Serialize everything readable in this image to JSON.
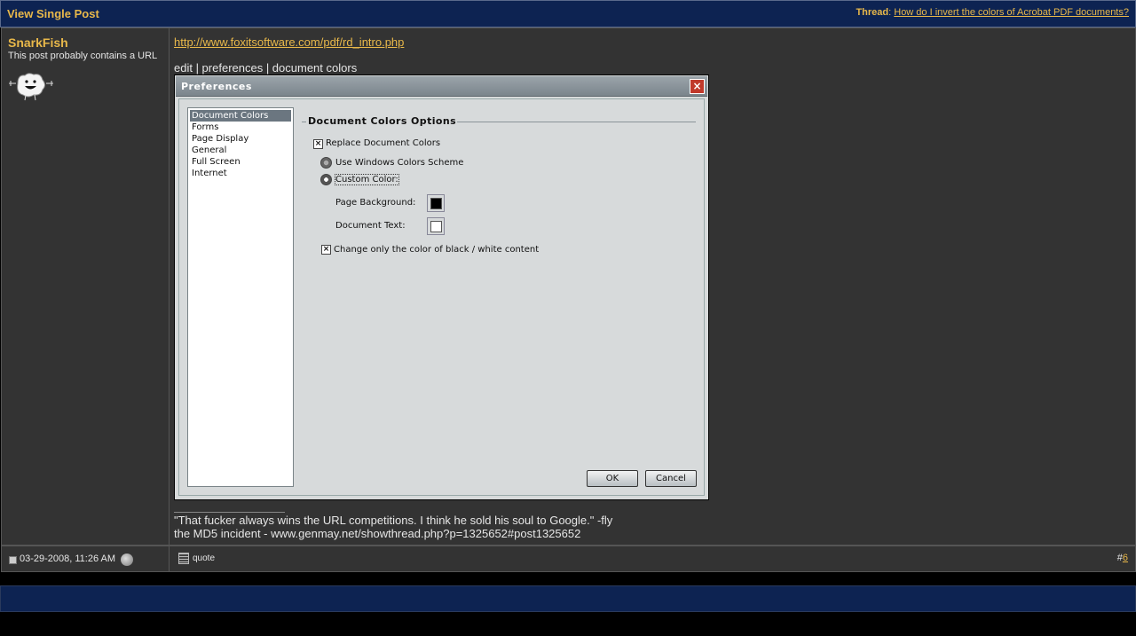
{
  "header": {
    "title": "View Single Post",
    "thread_label": "Thread",
    "thread_sep": ":",
    "thread_link": "How do I invert the colors of Acrobat PDF documents?"
  },
  "user": {
    "name": "SnarkFish",
    "title": "This post probably contains a URL",
    "avatar_icon": "cartoon-avatar-icon"
  },
  "post": {
    "link": "http://www.foxitsoftware.com/pdf/rd_intro.php",
    "path_text": "edit | preferences | document colors",
    "signature_line1": "\"That fucker always wins the URL competitions. I think he sold his soul to Google.\" -fly",
    "signature_line2": "the MD5 incident - www.genmay.net/showthread.php?p=1325652#post1325652"
  },
  "dialog": {
    "title": "Preferences",
    "categories": [
      "Document Colors",
      "Forms",
      "Page Display",
      "General",
      "Full Screen",
      "Internet"
    ],
    "selected_category": "Document Colors",
    "group_title": "Document Colors Options",
    "replace_label": "Replace Document Colors",
    "replace_checked": true,
    "radio_windows_label": "Use Windows Colors Scheme",
    "radio_custom_label": "Custom Color:",
    "selected_radio": "Custom Color:",
    "page_background_label": "Page Background:",
    "page_background_color": "#000000",
    "document_text_label": "Document Text:",
    "document_text_color": "#ffffff",
    "change_only_label": "Change only  the color of black / white content",
    "change_only_checked": true,
    "ok_label": "OK",
    "cancel_label": "Cancel"
  },
  "footer": {
    "date": "03-29-2008, 11:26 AM",
    "quote_label": "quote",
    "post_number_prefix": "#",
    "post_number": "6"
  },
  "colors": {
    "header_bg": "#0d2352",
    "accent": "#e8b84a",
    "panel_bg": "#333333"
  }
}
